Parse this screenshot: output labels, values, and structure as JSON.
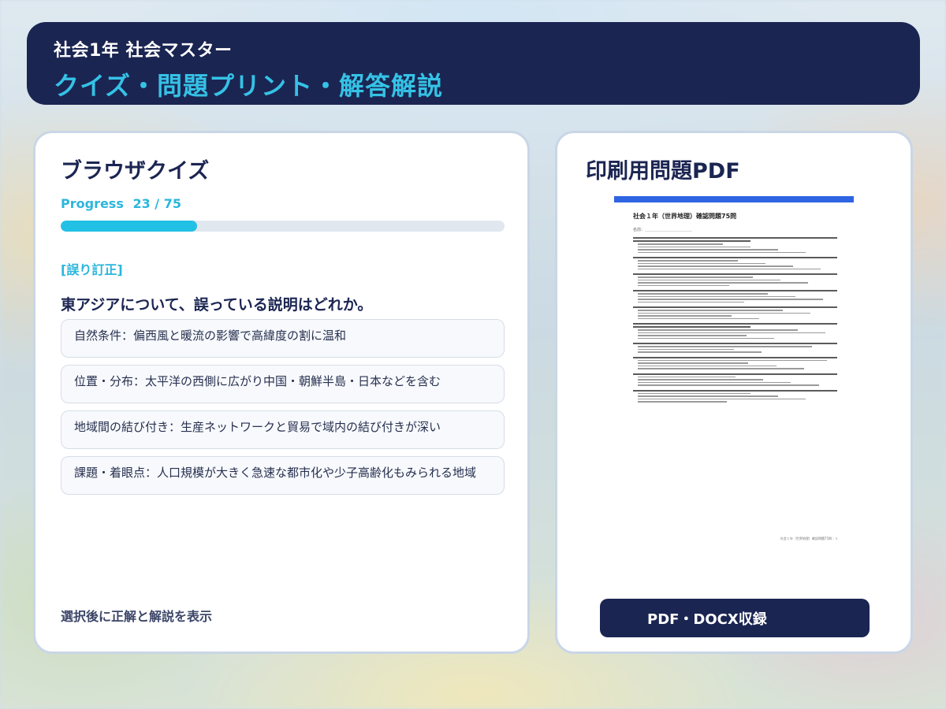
{
  "header": {
    "subtitle": "社会1年 社会マスター",
    "title": "クイズ・問題プリント・解答解説"
  },
  "quiz": {
    "title": "ブラウザクイズ",
    "progress": {
      "label": "Progress",
      "current": 23,
      "total": 75,
      "text": "23 / 75"
    },
    "tag": "[誤り訂正]",
    "question": "東アジアについて、誤っている説明はどれか。",
    "options": [
      "自然条件：偏西風と暖流の影響で高緯度の割に温和",
      "位置・分布：太平洋の西側に広がり中国・朝鮮半島・日本などを含む",
      "地域間の結び付き：生産ネットワークと貿易で域内の結び付きが深い",
      "課題・着眼点：人口規模が大きく急速な都市化や少子高齢化もみられる地域"
    ],
    "footnote": "選択後に正解と解説を表示"
  },
  "print": {
    "title": "印刷用問題PDF",
    "pdf_preview": {
      "doc_title": "社会１年（世界地理）確認問題75問",
      "name_line": "名前：＿＿＿＿＿＿＿＿＿＿＿＿",
      "footer": "社会１年（世界地理）確認問題75問｜１"
    },
    "button_label": "PDF・DOCX収録"
  },
  "colors": {
    "navy": "#1b2552",
    "accent": "#22c0e4",
    "pdf_bar": "#2f64e2"
  }
}
